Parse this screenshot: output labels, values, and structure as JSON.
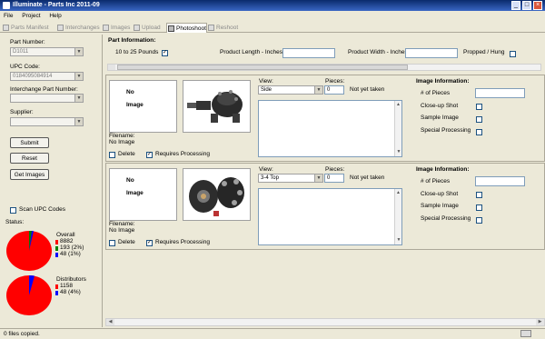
{
  "window": {
    "title": "Illuminate - Parts Inc 2011-09",
    "minimize": "_",
    "maximize": "□",
    "close": "×"
  },
  "menu": [
    "File",
    "Project",
    "Help"
  ],
  "tabs": [
    {
      "label": "Parts Manifest",
      "active": false
    },
    {
      "label": "Interchanges",
      "active": false
    },
    {
      "label": "Images",
      "active": false
    },
    {
      "label": "Upload",
      "active": false
    },
    {
      "label": "Photoshoot",
      "active": true
    },
    {
      "label": "Reshoot",
      "active": false
    }
  ],
  "left": {
    "part_number_label": "Part Number:",
    "part_number_value": "D1011",
    "upc_label": "UPC Code:",
    "upc_value": "0184095084914",
    "interchange_label": "Interchange Part Number:",
    "interchange_value": "",
    "supplier_label": "Supplier:",
    "supplier_value": "",
    "submit": "Submit",
    "reset": "Reset",
    "get_images": "Get Images",
    "scan_upc": "Scan UPC Codes",
    "status_label": "Status:"
  },
  "status": {
    "overall": {
      "label": "Overall",
      "values": [
        "8882",
        "193 (2%)",
        "48 (1%)"
      ],
      "colors": [
        "#ff0000",
        "#008000",
        "#0000ff"
      ]
    },
    "distributors": {
      "label": "Distributors",
      "values": [
        "1158",
        "48 (4%)"
      ],
      "colors": [
        "#ff0000",
        "#0000ff"
      ]
    }
  },
  "part_info": {
    "header": "Part Information:",
    "weight": "10 to 25 Pounds",
    "weight_checked": "✓",
    "length_label": "Product Length - Inches",
    "width_label": "Product Width - Inches",
    "propped_label": "Propped / Hung"
  },
  "rows": [
    {
      "no_image": "No",
      "no_image2": "Image",
      "filename_label": "Filename:",
      "filename_value": "No Image",
      "delete_label": "Delete",
      "requires_label": "Requires Processing",
      "requires_checked": "✓",
      "view_label": "View:",
      "view_value": "Side",
      "pieces_label": "Pieces:",
      "pieces_value": "0",
      "taken": "Not yet taken",
      "info_header": "Image Information:",
      "num_pieces": "# of Pieces",
      "closeup": "Close-up Shot",
      "sample": "Sample Image",
      "special": "Special Processing"
    },
    {
      "no_image": "No",
      "no_image2": "Image",
      "filename_label": "Filename:",
      "filename_value": "No Image",
      "delete_label": "Delete",
      "requires_label": "Requires Processing",
      "requires_checked": "✓",
      "view_label": "View:",
      "view_value": "3-4 Top",
      "pieces_label": "Pieces:",
      "pieces_value": "0",
      "taken": "Not yet taken",
      "info_header": "Image Information:",
      "num_pieces": "# of Pieces",
      "closeup": "Close-up Shot",
      "sample": "Sample Image",
      "special": "Special Processing"
    }
  ],
  "statusbar": "0 files copied."
}
